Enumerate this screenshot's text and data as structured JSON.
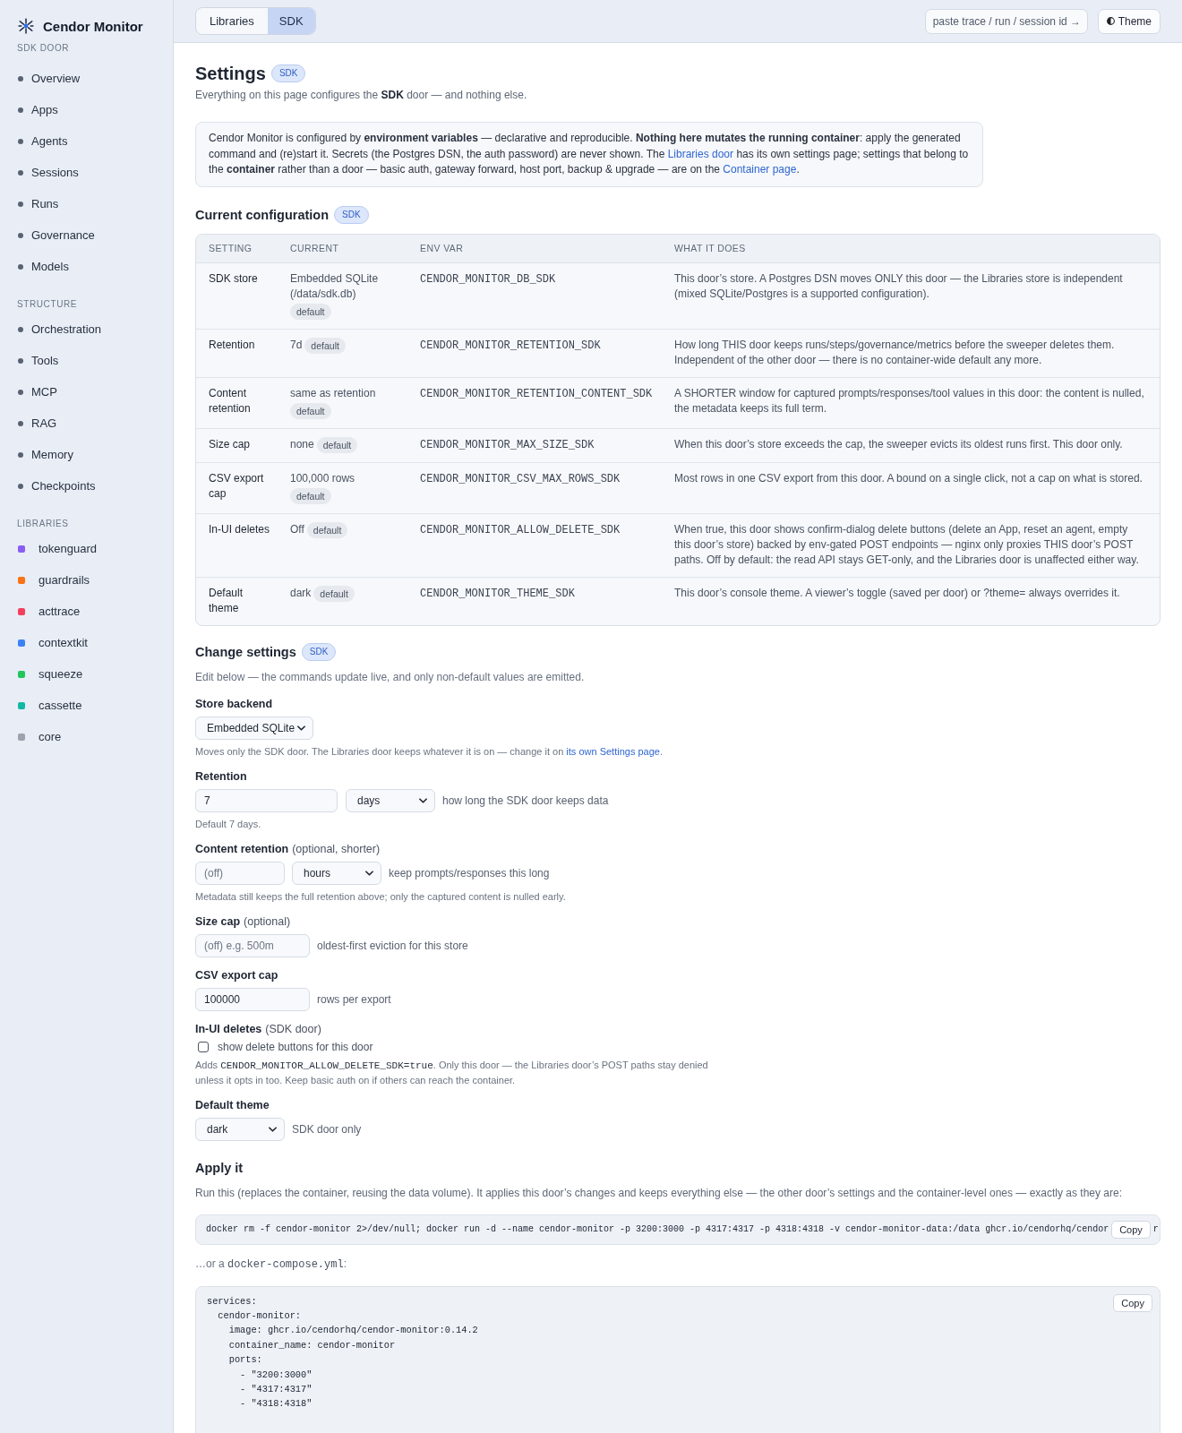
{
  "sidebar": {
    "brand": "Cendor Monitor",
    "sections": [
      {
        "heading": "SDK DOOR",
        "kind": "pages",
        "items": [
          {
            "label": "Overview"
          },
          {
            "label": "Apps"
          },
          {
            "label": "Agents"
          },
          {
            "label": "Sessions"
          },
          {
            "label": "Runs"
          },
          {
            "label": "Governance"
          },
          {
            "label": "Models"
          }
        ]
      },
      {
        "heading": "STRUCTURE",
        "kind": "pages",
        "items": [
          {
            "label": "Orchestration"
          },
          {
            "label": "Tools"
          },
          {
            "label": "MCP"
          },
          {
            "label": "RAG"
          },
          {
            "label": "Memory"
          },
          {
            "label": "Checkpoints"
          }
        ]
      },
      {
        "heading": "LIBRARIES",
        "kind": "libraries",
        "items": [
          {
            "label": "tokenguard",
            "color": "#8b5cf6"
          },
          {
            "label": "guardrails",
            "color": "#f97316"
          },
          {
            "label": "acttrace",
            "color": "#f43f5e"
          },
          {
            "label": "contextkit",
            "color": "#3b82f6"
          },
          {
            "label": "squeeze",
            "color": "#22c55e"
          },
          {
            "label": "cassette",
            "color": "#14b8a6"
          },
          {
            "label": "core",
            "color": "#9ca3af"
          }
        ]
      }
    ]
  },
  "topbar": {
    "tabs": [
      {
        "label": "Libraries",
        "selected": false
      },
      {
        "label": "SDK",
        "selected": true
      }
    ],
    "search": {
      "placeholder": "paste trace / run / session id →"
    },
    "theme_button": {
      "label": "Theme"
    }
  },
  "page": {
    "title": "Settings",
    "badge": "SDK",
    "subtitle": "Everything on this page configures the **SDK** door — and nothing else.",
    "note": [
      {
        "kind": "text",
        "text": "Cendor Monitor is configured by **environment variables** — declarative and reproducible. **Nothing here mutates the running container**: apply the generated command and (re)start it. Secrets (the Postgres DSN, the auth password) are never shown. The "
      },
      {
        "kind": "link",
        "text": "Libraries door"
      },
      {
        "kind": "text",
        "text": " has its own settings page; settings that belong to the **container** rather than a door — basic auth, gateway forward, host port, backup & upgrade — are on the "
      },
      {
        "kind": "link",
        "text": "Container page"
      },
      {
        "kind": "text",
        "text": "."
      }
    ]
  },
  "current": {
    "title": "Current configuration",
    "badge": "SDK",
    "columns": [
      "SETTING",
      "CURRENT",
      "ENV VAR",
      "WHAT IT DOES"
    ],
    "rows": [
      {
        "setting": "SDK store",
        "current": "Embedded SQLite (/data/sdk.db)",
        "badge": "default",
        "env_var": "CENDOR_MONITOR_DB_SDK",
        "description": "This door’s store. A Postgres DSN moves ONLY this door — the Libraries store is independent (mixed SQLite/Postgres is a supported configuration)."
      },
      {
        "setting": "Retention",
        "current": "7d",
        "badge": "default",
        "env_var": "CENDOR_MONITOR_RETENTION_SDK",
        "description": "How long THIS door keeps runs/steps/governance/metrics before the sweeper deletes them. Independent of the other door — there is no container-wide default any more."
      },
      {
        "setting": "Content retention",
        "current": "same as retention",
        "badge": "default",
        "env_var": "CENDOR_MONITOR_RETENTION_CONTENT_SDK",
        "description": "A SHORTER window for captured prompts/responses/tool values in this door: the content is nulled, the metadata keeps its full term."
      },
      {
        "setting": "Size cap",
        "current": "none",
        "badge": "default",
        "env_var": "CENDOR_MONITOR_MAX_SIZE_SDK",
        "description": "When this door’s store exceeds the cap, the sweeper evicts its oldest runs first. This door only."
      },
      {
        "setting": "CSV export cap",
        "current": "100,000 rows",
        "badge": "default",
        "env_var": "CENDOR_MONITOR_CSV_MAX_ROWS_SDK",
        "description": "Most rows in one CSV export from this door. A bound on a single click, not a cap on what is stored."
      },
      {
        "setting": "In-UI deletes",
        "current": "Off",
        "badge": "default",
        "env_var": "CENDOR_MONITOR_ALLOW_DELETE_SDK",
        "description": "When true, this door shows confirm-dialog delete buttons (delete an App, reset an agent, empty this door’s store) backed by env-gated POST endpoints — nginx only proxies THIS door’s POST paths. Off by default: the read API stays GET-only, and the Libraries door is unaffected either way."
      },
      {
        "setting": "Default theme",
        "current": "dark",
        "badge": "default",
        "env_var": "CENDOR_MONITOR_THEME_SDK",
        "description": "This door’s console theme. A viewer’s toggle (saved per door) or ?theme= always overrides it."
      }
    ]
  },
  "change": {
    "title": "Change settings",
    "badge": "SDK",
    "subtitle": "Edit below — the commands update live, and only non-default values are emitted.",
    "fields": [
      {
        "label": "Store backend",
        "controls": [
          {
            "kind": "select",
            "value": "Embedded SQLite"
          }
        ],
        "help": [
          {
            "kind": "text",
            "text": "Moves only the SDK door. The Libraries door keeps whatever it is on — change it on "
          },
          {
            "kind": "link",
            "text": "its own Settings page"
          },
          {
            "kind": "text",
            "text": "."
          }
        ]
      },
      {
        "label": "Retention",
        "controls": [
          {
            "kind": "input",
            "value": "7"
          },
          {
            "kind": "select",
            "value": "days"
          }
        ],
        "hint": "how long the SDK door keeps data",
        "help": [
          {
            "kind": "text",
            "text": "Default 7 days."
          }
        ]
      },
      {
        "label": "Content retention",
        "label_note": "(optional, shorter)",
        "controls": [
          {
            "kind": "input",
            "placeholder": "(off)"
          },
          {
            "kind": "select",
            "value": "hours"
          }
        ],
        "hint": "keep prompts/responses this long",
        "help": [
          {
            "kind": "text",
            "text": "Metadata still keeps the full retention above; only the captured content is nulled early."
          }
        ]
      },
      {
        "label": "Size cap",
        "label_note": "(optional)",
        "controls": [
          {
            "kind": "input",
            "placeholder": "(off) e.g. 500m"
          }
        ],
        "hint": "oldest-first eviction for this store"
      },
      {
        "label": "CSV export cap",
        "controls": [
          {
            "kind": "input",
            "value": "100000"
          }
        ],
        "hint": "rows per export"
      },
      {
        "label": "In-UI deletes",
        "label_note": "(SDK door)",
        "controls": [
          {
            "kind": "checkbox",
            "checked": false,
            "label": "show delete buttons for this door"
          }
        ],
        "help": [
          {
            "kind": "text",
            "text": "Adds "
          },
          {
            "kind": "code",
            "text": "CENDOR_MONITOR_ALLOW_DELETE_SDK=true"
          },
          {
            "kind": "text",
            "text": ". Only this door — the Libraries door’s POST paths stay denied unless it opts in too. Keep basic auth on if others can reach the container."
          }
        ]
      },
      {
        "label": "Default theme",
        "controls": [
          {
            "kind": "select",
            "value": "dark"
          }
        ],
        "hint": "SDK door only"
      }
    ]
  },
  "apply": {
    "title": "Apply it",
    "intro": "Run this (replaces the container, reusing the data volume). It applies this door’s changes and keeps everything else — the other door’s settings and the container-level ones — exactly as they are:",
    "command": {
      "code": "docker rm -f cendor-monitor 2>/dev/null; docker run -d --name cendor-monitor -p 3200:3000 -p 4317:4317 -p 4318:4318 -v cendor-monitor-data:/data ghcr.io/cendorhq/cendor",
      "copy_label": "Copy",
      "tail": "r"
    },
    "compose_intro": [
      {
        "kind": "text",
        "text": "…or a "
      },
      {
        "kind": "code",
        "text": "docker-compose.yml"
      },
      {
        "kind": "text",
        "text": ":"
      }
    ],
    "compose": {
      "copy_label": "Copy",
      "lines": [
        "services:",
        "  cendor-monitor:",
        "    image: ghcr.io/cendorhq/cendor-monitor:0.14.2",
        "    container_name: cendor-monitor",
        "    ports:",
        "      - \"3200:3000\"",
        "      - \"4317:4317\"",
        "      - \"4318:4318\""
      ]
    }
  }
}
